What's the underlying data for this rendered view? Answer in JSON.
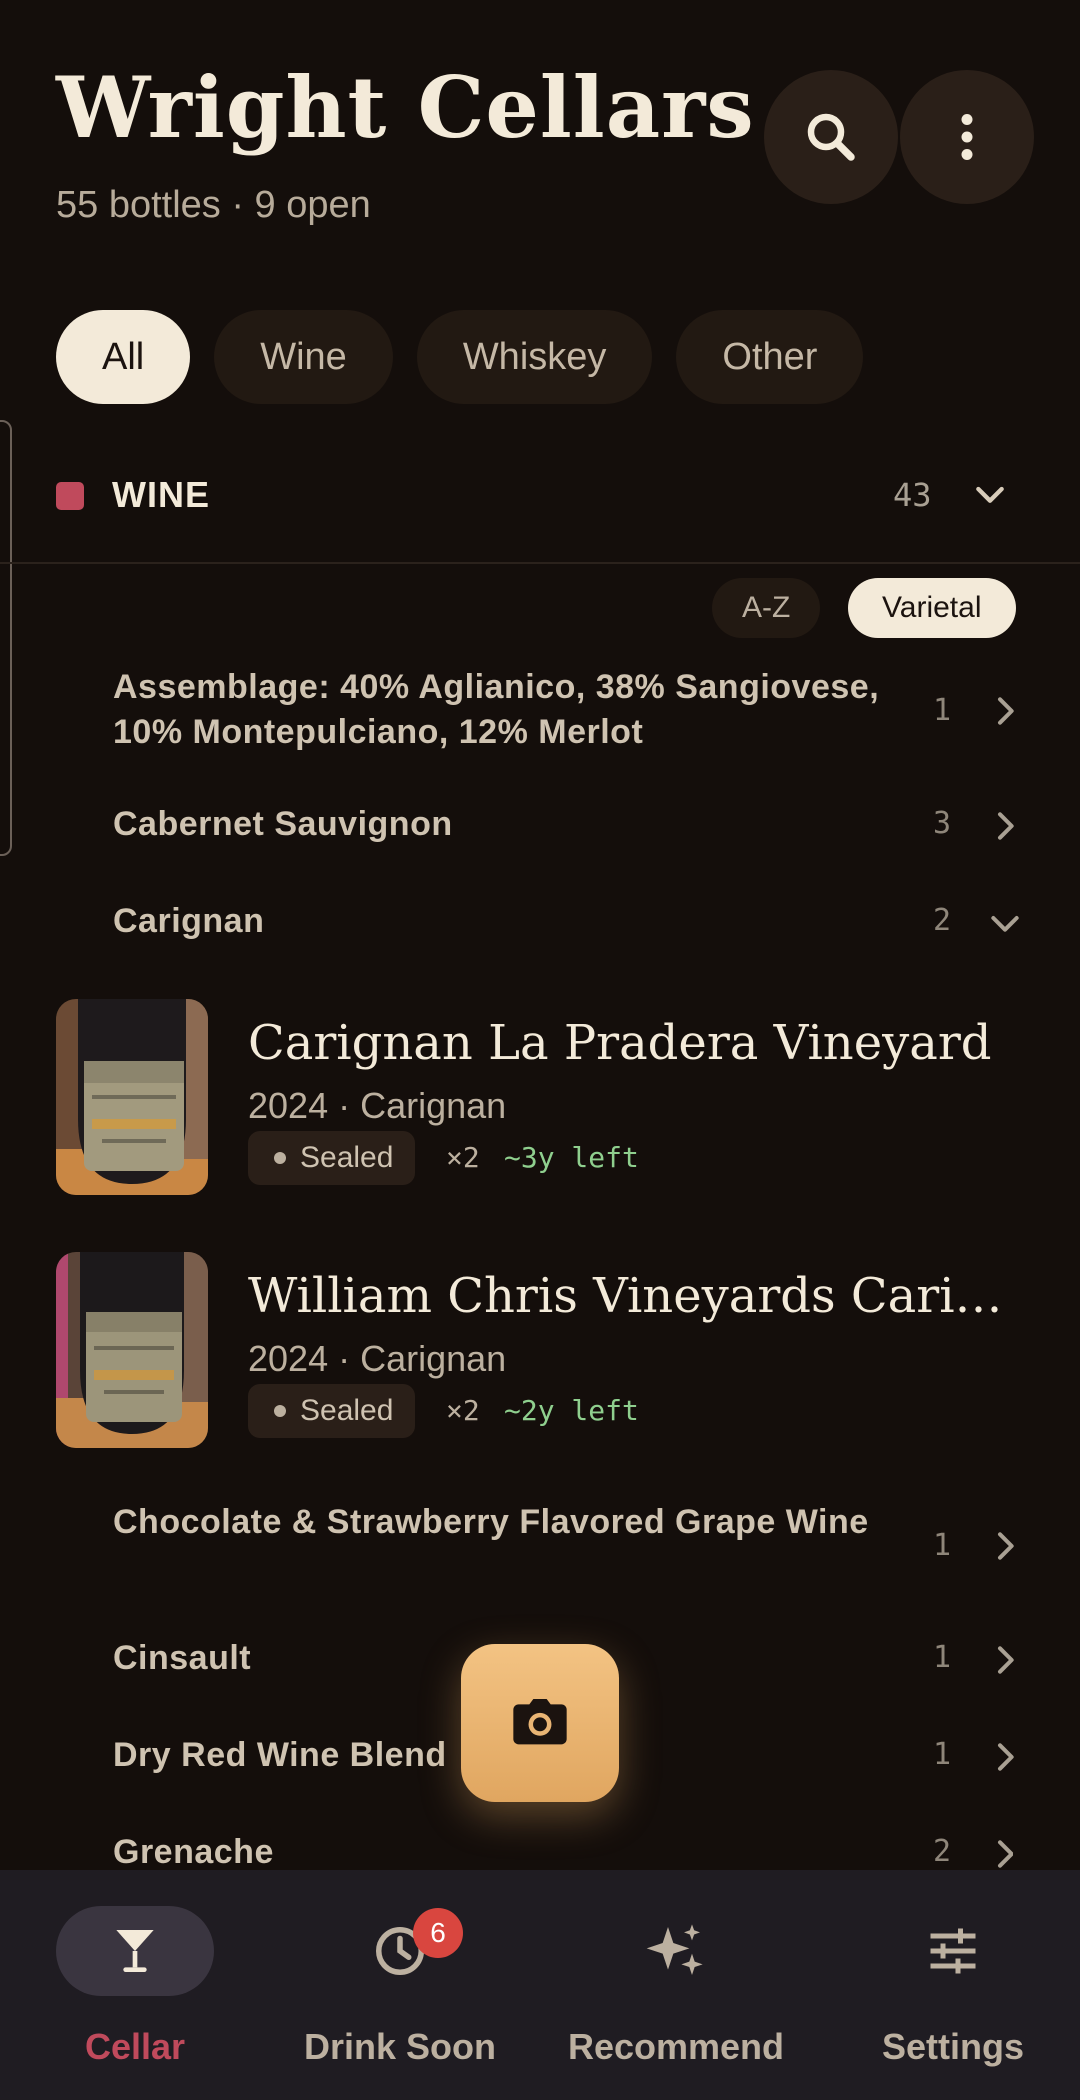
{
  "header": {
    "title": "Wright  Cellars",
    "subtitle": "55 bottles · 9 open"
  },
  "filters": [
    "All",
    "Wine",
    "Whiskey",
    "Other"
  ],
  "section": {
    "label": "WINE",
    "count": "43"
  },
  "sort": {
    "az": "A-Z",
    "varietal": "Varietal"
  },
  "varietals": [
    {
      "name": "Assemblage: 40% Aglianico, 38% Sangiovese, 10% Montepulciano, 12% Merlot",
      "count": "1"
    },
    {
      "name": "Cabernet Sauvignon",
      "count": "3"
    },
    {
      "name": "Carignan",
      "count": "2"
    },
    {
      "name": "Chocolate & Strawberry Flavored Grape Wine",
      "count": "1"
    },
    {
      "name": "Cinsault",
      "count": "1"
    },
    {
      "name": "Dry Red Wine Blend",
      "count": "1"
    },
    {
      "name": "Grenache",
      "count": "2"
    }
  ],
  "wines": [
    {
      "title": "Carignan La Pradera Vineyard",
      "sub": "2024 · Carignan",
      "status": "Sealed",
      "qty": "×2",
      "left": "~3y left"
    },
    {
      "title": "William Chris Vineyards Carignan",
      "sub": "2024 · Carignan",
      "status": "Sealed",
      "qty": "×2",
      "left": "~2y left"
    }
  ],
  "nav": {
    "cellar": "Cellar",
    "drink_soon": "Drink Soon",
    "drink_soon_badge": "6",
    "recommend": "Recommend",
    "settings": "Settings"
  },
  "colors": {
    "accent": "#c04a5c",
    "fab": "#e9b574",
    "left_green": "#8fcf8e"
  },
  "icons": [
    "search-icon",
    "more-vert-icon",
    "chevron-down-icon",
    "chevron-right-icon",
    "camera-icon",
    "cocktail-glass-icon",
    "clock-icon",
    "sparkles-icon",
    "sliders-icon"
  ]
}
